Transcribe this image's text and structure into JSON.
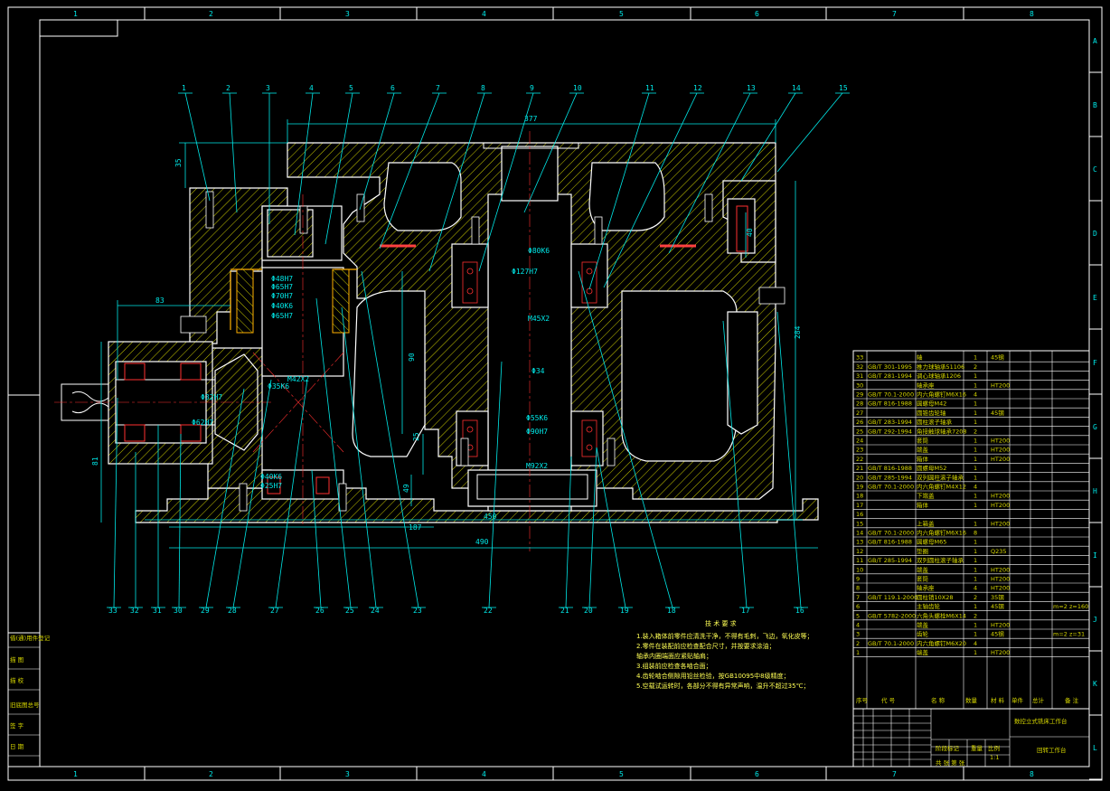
{
  "zones": {
    "top_cols": [
      "1",
      "2",
      "3",
      "4",
      "5",
      "6",
      "7",
      "8"
    ],
    "bottom_cols": [
      "1",
      "2",
      "3",
      "4",
      "5",
      "6",
      "7",
      "8"
    ],
    "right_rows": [
      "A",
      "B",
      "C",
      "D",
      "E",
      "F",
      "G",
      "H",
      "I",
      "J",
      "K",
      "L"
    ]
  },
  "leaders_top": [
    "1",
    "2",
    "3",
    "4",
    "5",
    "6",
    "7",
    "8",
    "9",
    "10",
    "11",
    "12",
    "13",
    "14",
    "15"
  ],
  "leaders_bottom": [
    "33",
    "32",
    "31",
    "30",
    "29",
    "28",
    "27",
    "26",
    "25",
    "24",
    "23",
    "22",
    "21",
    "20",
    "19",
    "18",
    "17",
    "16"
  ],
  "dims": {
    "d377": "377",
    "d35": "35",
    "d83": "83",
    "d81": "81",
    "d187": "187",
    "d450": "450",
    "d490": "490",
    "d90": "90",
    "d25": "25",
    "d49": "49",
    "d284": "284",
    "d40": "40"
  },
  "section_labels": [
    "Φ48H7",
    "Φ65H7",
    "Φ70H7",
    "Φ40K6",
    "Φ65H7",
    "Φ127H7",
    "Φ80K6",
    "M45X2",
    "Φ34",
    "Φ55K6",
    "Φ90H7",
    "M92X2",
    "M42X2",
    "Φ35K6",
    "Φ32H7",
    "Φ62H7",
    "Φ40K6",
    "Φ25H7"
  ],
  "tech": {
    "title": "技 术 要 求",
    "lines": [
      "1.装入箱体前零件应清洗干净，不得有毛刺，飞边，氧化皮等；",
      "2.零件在装配前应检查配合尺寸，并按要求涂油；",
      "  轴承内圈端面应紧贴轴肩；",
      "3.组装前应检查各啮合面；",
      "4.齿轮啮合侧隙用铅丝检验，按GB10095中8级精度；",
      "5.空载试运转时，各部分不得有异常声响，温升不超过35℃；"
    ]
  },
  "bom": {
    "rows": [
      {
        "no": "33",
        "std": "",
        "name": "轴",
        "qty": "1",
        "mat": "45钢",
        "note": ""
      },
      {
        "no": "32",
        "std": "GB/T 301-1995",
        "name": "推力球轴承51106",
        "qty": "2",
        "mat": "",
        "note": ""
      },
      {
        "no": "31",
        "std": "GB/T 281-1994",
        "name": "调心球轴承1206",
        "qty": "1",
        "mat": "",
        "note": ""
      },
      {
        "no": "30",
        "std": "",
        "name": "轴承座",
        "qty": "1",
        "mat": "HT200",
        "note": ""
      },
      {
        "no": "29",
        "std": "GB/T 70.1-2000",
        "name": "内六角螺钉M6X16",
        "qty": "4",
        "mat": "",
        "note": ""
      },
      {
        "no": "28",
        "std": "GB/T 816-1988",
        "name": "圆螺母M42",
        "qty": "1",
        "mat": "",
        "note": ""
      },
      {
        "no": "27",
        "std": "",
        "name": "圆锥齿轮轴",
        "qty": "1",
        "mat": "45钢",
        "note": ""
      },
      {
        "no": "26",
        "std": "GB/T 283-1994",
        "name": "圆柱滚子轴承",
        "qty": "1",
        "mat": "",
        "note": ""
      },
      {
        "no": "25",
        "std": "GB/T 292-1994",
        "name": "角接触球轴承7208",
        "qty": "2",
        "mat": "",
        "note": ""
      },
      {
        "no": "24",
        "std": "",
        "name": "套筒",
        "qty": "1",
        "mat": "HT200",
        "note": ""
      },
      {
        "no": "23",
        "std": "",
        "name": "端盖",
        "qty": "1",
        "mat": "HT200",
        "note": ""
      },
      {
        "no": "22",
        "std": "",
        "name": "箱体",
        "qty": "1",
        "mat": "HT200",
        "note": ""
      },
      {
        "no": "21",
        "std": "GB/T 816-1988",
        "name": "圆螺母M52",
        "qty": "1",
        "mat": "",
        "note": ""
      },
      {
        "no": "20",
        "std": "GB/T 285-1994",
        "name": "双列圆柱滚子轴承",
        "qty": "1",
        "mat": "",
        "note": ""
      },
      {
        "no": "19",
        "std": "GB/T 70.1-2000",
        "name": "内六角螺钉M4X12",
        "qty": "4",
        "mat": "",
        "note": ""
      },
      {
        "no": "18",
        "std": "",
        "name": "下端盖",
        "qty": "1",
        "mat": "HT200",
        "note": ""
      },
      {
        "no": "17",
        "std": "",
        "name": "箱体",
        "qty": "1",
        "mat": "HT200",
        "note": ""
      },
      {
        "no": "16",
        "std": "",
        "name": "",
        "qty": "",
        "mat": "",
        "note": ""
      },
      {
        "no": "15",
        "std": "",
        "name": "上箱盖",
        "qty": "1",
        "mat": "HT200",
        "note": ""
      },
      {
        "no": "14",
        "std": "GB/T 70.1-2000",
        "name": "内六角螺钉M6X16",
        "qty": "8",
        "mat": "",
        "note": ""
      },
      {
        "no": "13",
        "std": "GB/T 816-1988",
        "name": "圆螺母M65",
        "qty": "1",
        "mat": "",
        "note": ""
      },
      {
        "no": "12",
        "std": "",
        "name": "垫圈",
        "qty": "1",
        "mat": "Q235",
        "note": ""
      },
      {
        "no": "11",
        "std": "GB/T 285-1994",
        "name": "双列圆柱滚子轴承",
        "qty": "1",
        "mat": "",
        "note": ""
      },
      {
        "no": "10",
        "std": "",
        "name": "端盖",
        "qty": "1",
        "mat": "HT200",
        "note": ""
      },
      {
        "no": "9",
        "std": "",
        "name": "套筒",
        "qty": "1",
        "mat": "HT200",
        "note": ""
      },
      {
        "no": "8",
        "std": "",
        "name": "轴承座",
        "qty": "4",
        "mat": "HT200",
        "note": ""
      },
      {
        "no": "7",
        "std": "GB/T 119.1-2000",
        "name": "圆柱销10X28",
        "qty": "2",
        "mat": "35钢",
        "note": ""
      },
      {
        "no": "6",
        "std": "",
        "name": "主轴齿轮",
        "qty": "1",
        "mat": "45钢",
        "note": "m=2 z=160"
      },
      {
        "no": "5",
        "std": "GB/T 5782-2000",
        "name": "六角头螺栓M6X14",
        "qty": "2",
        "mat": "",
        "note": ""
      },
      {
        "no": "4",
        "std": "",
        "name": "端盖",
        "qty": "1",
        "mat": "HT200",
        "note": ""
      },
      {
        "no": "3",
        "std": "",
        "name": "齿轮",
        "qty": "1",
        "mat": "45钢",
        "note": "m=2 z=31"
      },
      {
        "no": "2",
        "std": "GB/T 70.1-2000",
        "name": "内六角螺钉M6X20",
        "qty": "4",
        "mat": "",
        "note": ""
      },
      {
        "no": "1",
        "std": "",
        "name": "端盖",
        "qty": "1",
        "mat": "HT200",
        "note": ""
      }
    ],
    "header": {
      "no": "序号",
      "std": "代 号",
      "name": "名 称",
      "qty": "数量",
      "mat": "材 料",
      "w1": "单件",
      "w2": "总计",
      "note": "备 注"
    }
  },
  "title_block": {
    "design_title": "数控立式铣床工作台",
    "drawing_name": "回转工作台",
    "scale_label": "比例",
    "scale": "1:1",
    "stage_label": "阶段标记",
    "weight_label": "重量",
    "sheet_info": "共  张  第  张"
  },
  "side_stamp": [
    "借(通)用件登记",
    "描 图",
    "描 校",
    "旧底图总号",
    "签 字",
    "日 期"
  ]
}
